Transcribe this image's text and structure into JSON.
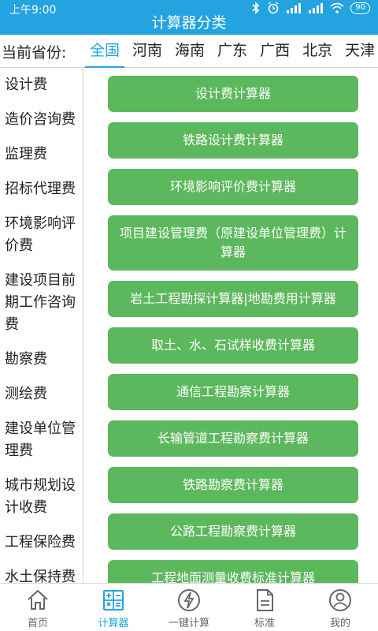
{
  "status_bar": {
    "time": "上午9:00",
    "battery": "90"
  },
  "header": {
    "title": "计算器分类"
  },
  "province": {
    "label": "当前省份:",
    "tabs": [
      "全国",
      "河南",
      "海南",
      "广东",
      "广西",
      "北京",
      "天津"
    ],
    "selected": "全国"
  },
  "sidebar": {
    "items": [
      "设计费",
      "造价咨询费",
      "监理费",
      "招标代理费",
      "环境影响评价费",
      "建设项目前期工作咨询费",
      "勘察费",
      "测绘费",
      "建设单位管理费",
      "城市规划设计收费",
      "工程保险费",
      "水土保持费"
    ]
  },
  "calculators": [
    "设计费计算器",
    "铁路设计费计算器",
    "环境影响评价费计算器",
    "项目建设管理费（原建设单位管理费）计算器",
    "岩土工程勘探计算器|地勘费用计算器",
    "取土、水、石试样收费计算器",
    "通信工程勘察计算器",
    "长输管道工程勘察费计算器",
    "铁路勘察费计算器",
    "公路工程勘察费计算器",
    "工程地面测量收费标准计算器"
  ],
  "bottom_nav": {
    "items": [
      {
        "label": "首页",
        "icon": "home-icon"
      },
      {
        "label": "计算器",
        "icon": "calculator-icon"
      },
      {
        "label": "一键计算",
        "icon": "lightning-icon"
      },
      {
        "label": "标准",
        "icon": "document-icon"
      },
      {
        "label": "我的",
        "icon": "user-icon"
      }
    ],
    "active": "计算器"
  },
  "colors": {
    "primary": "#23a3e0",
    "button": "#5cb85c"
  }
}
